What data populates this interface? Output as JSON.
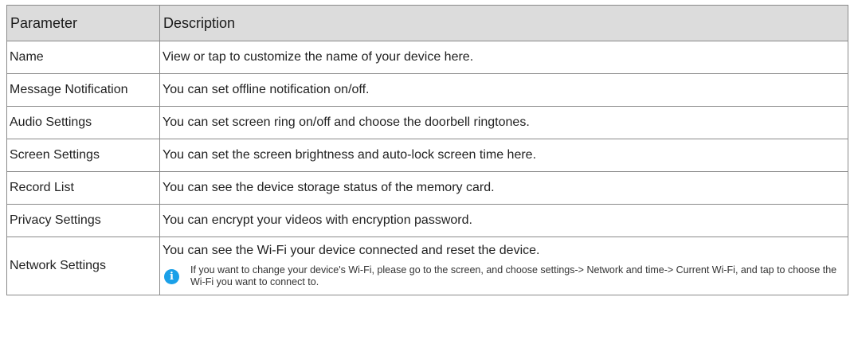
{
  "table": {
    "headers": [
      "Parameter",
      "Description"
    ],
    "rows": [
      {
        "parameter": "Name",
        "description": "View or tap to customize the name of your device here."
      },
      {
        "parameter": "Message Notification",
        "description": "You can set offline notification on/off."
      },
      {
        "parameter": "Audio Settings",
        "description": "You can set screen ring on/off and choose the doorbell ringtones."
      },
      {
        "parameter": "Screen Settings",
        "description": "You can set the screen brightness and auto-lock screen time here."
      },
      {
        "parameter": "Record List",
        "description": "You can see the device storage status of the memory card."
      },
      {
        "parameter": "Privacy Settings",
        "description": "You can encrypt your videos with encryption password."
      },
      {
        "parameter": "Network Settings",
        "description": "You can see the Wi-Fi your device connected and reset the device.",
        "note": "If you want to change your device's Wi-Fi, please go to the screen, and choose settings-> Network and time-> Current Wi-Fi, and tap to choose the Wi-Fi you want to connect to.",
        "note_icon": "info-icon"
      }
    ]
  },
  "colors": {
    "header_bg": "#dcdcdc",
    "border": "#8a8a8a",
    "info_icon": "#1aa0e8"
  }
}
